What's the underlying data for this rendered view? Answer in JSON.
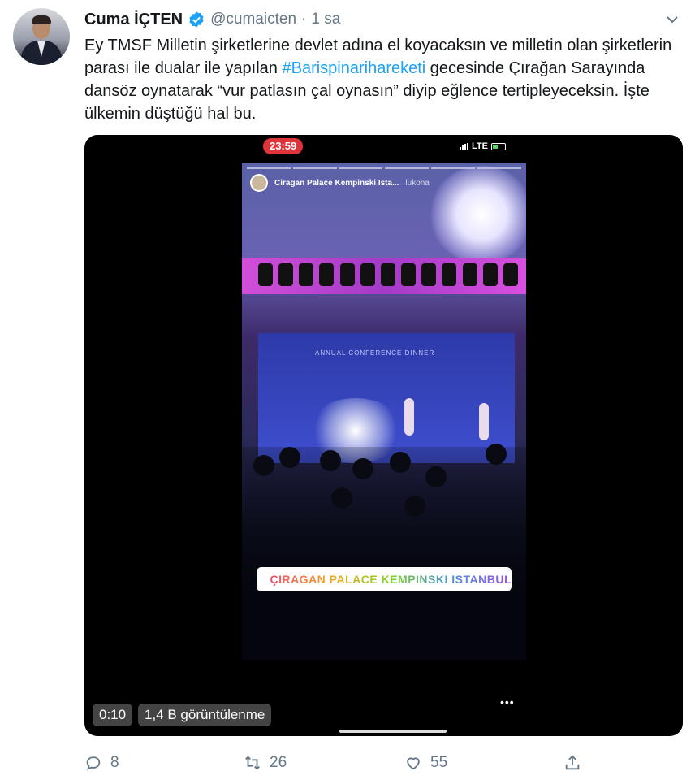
{
  "author": {
    "name": "Cuma İÇTEN",
    "handle": "@cumaicten",
    "separator": "·",
    "time": "1 sa",
    "verified": true
  },
  "tweet": {
    "text_part1": "Ey TMSF Milletin şirketlerine devlet adına el koyacaksın ve milletin olan şirketlerin parası ile dualar ile yapılan ",
    "hashtag": "#Barispinarihareketi",
    "text_part2": " gecesinde Çırağan Sarayında dansöz oynatarak “vur patlasın çal oynasın” diyip eğlence tertipleyeceksin. İşte ülkemin düştüğü hal bu."
  },
  "media": {
    "phone_clock": "23:59",
    "network": "LTE",
    "story_location_header": "Ciragan Palace Kempinski Ista...",
    "story_user": "lukona",
    "stage_screen_text": "ANNUAL CONFERENCE DINNER",
    "location_sticker": "ÇIRAGAN PALACE KEMPINSKI ISTANBUL",
    "more_indicator": "•••",
    "video_time": "0:10",
    "views": "1,4 B görüntülenme"
  },
  "actions": {
    "replies": "8",
    "retweets": "26",
    "likes": "55"
  },
  "colors": {
    "link": "#1da1f2",
    "secondary_text": "#657786",
    "recording_badge": "#e0343b"
  },
  "icons": [
    "verified-badge-icon",
    "chevron-down-icon",
    "reply-icon",
    "retweet-icon",
    "like-icon",
    "share-icon",
    "location-pin-icon",
    "signal-bars-icon",
    "battery-icon"
  ]
}
